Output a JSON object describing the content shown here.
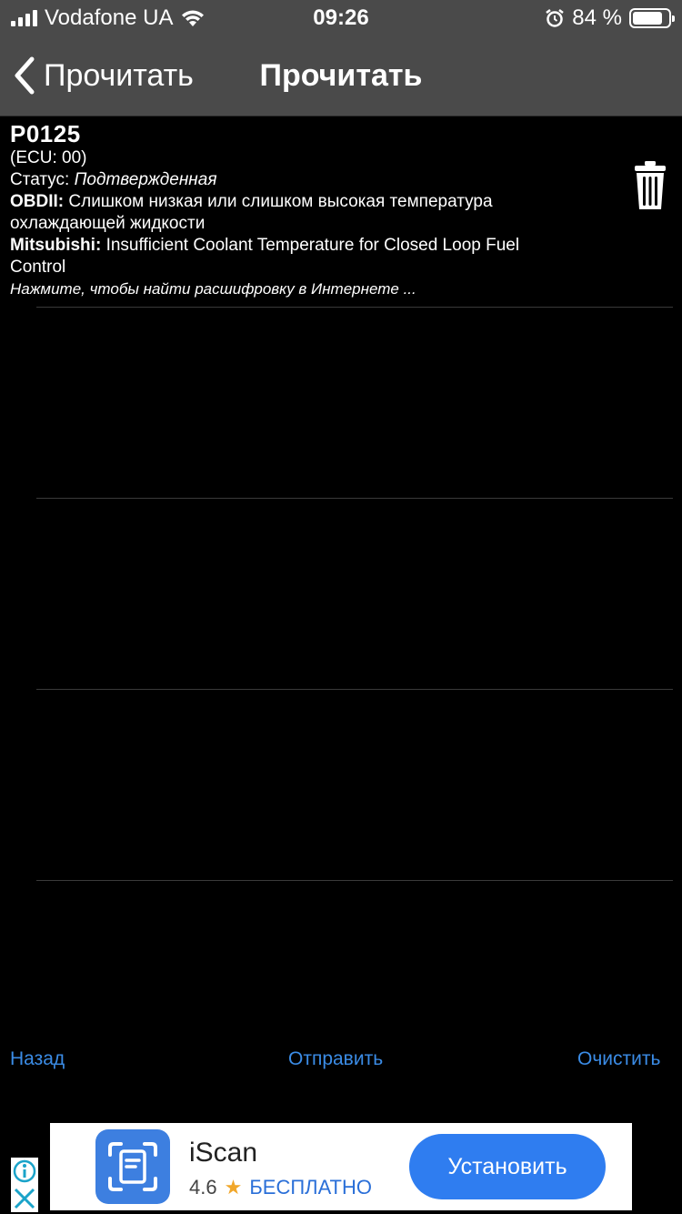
{
  "status_bar": {
    "carrier": "Vodafone UA",
    "time": "09:26",
    "battery_percent_label": "84 %",
    "battery_level": 0.84,
    "icons": [
      "signal-icon",
      "wifi-icon",
      "alarm-icon",
      "battery-icon"
    ]
  },
  "nav": {
    "back_label": "Прочитать",
    "title": "Прочитать"
  },
  "dtc": {
    "code": "P0125",
    "ecu": "(ECU: 00)",
    "status_label": "Статус:",
    "status_value": "Подтвержденная",
    "obd_label": "OBDII:",
    "obd_desc": "Слишком низкая или слишком высокая температура охлаждающей жидкости",
    "maker_label": "Mitsubishi:",
    "maker_desc": "Insufficient Coolant Temperature for Closed Loop Fuel Control",
    "search_hint": "Нажмите, чтобы найти расшифровку в Интернете ..."
  },
  "toolbar": {
    "back": "Назад",
    "send": "Отправить",
    "clear": "Очистить"
  },
  "ad": {
    "app_name": "iScan",
    "rating": "4.6",
    "price": "БЕСПЛАТНО",
    "install_label": "Установить"
  },
  "colors": {
    "bar_bg": "#4a4a4a",
    "page_bg": "#000000",
    "link_blue": "#3b8ce6",
    "install_blue": "#2f7df0"
  }
}
